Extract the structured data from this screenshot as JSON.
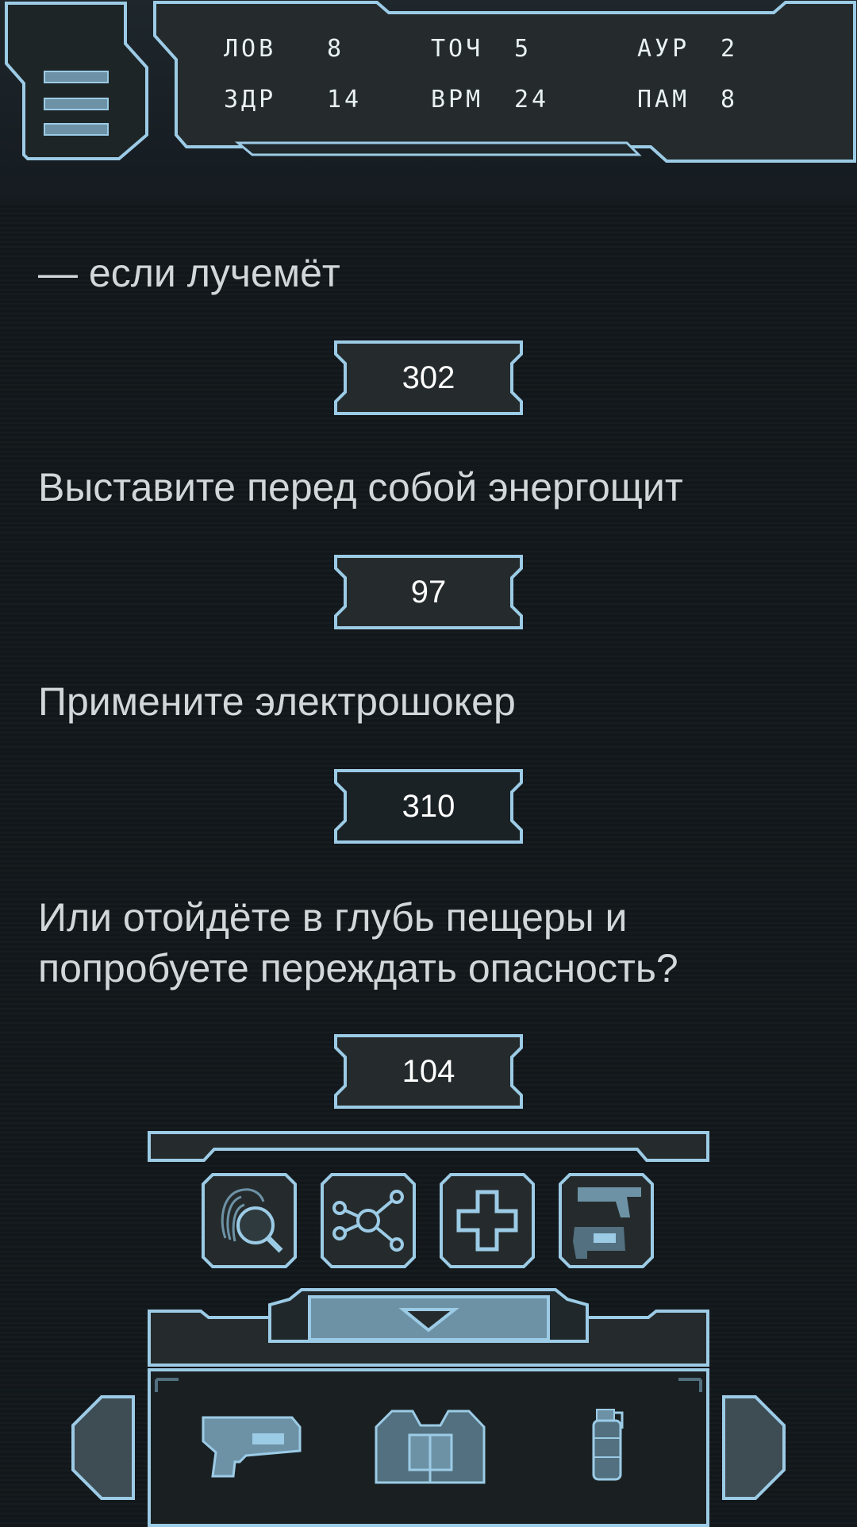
{
  "stats": {
    "row1": [
      {
        "label": "ЛОВ",
        "value": "8"
      },
      {
        "label": "ТОЧ",
        "value": "5"
      },
      {
        "label": "АУР",
        "value": "2"
      }
    ],
    "row2": [
      {
        "label": "ЗДР",
        "value": "14"
      },
      {
        "label": "ВРМ",
        "value": "24"
      },
      {
        "label": "ПАМ",
        "value": "8"
      }
    ]
  },
  "story": {
    "lines": [
      "— если лучемёт",
      "Выставите перед собой энергощит",
      "Примените электрошокер",
      "Или отойдёте в глубь пещеры и попробуете переждать опасность?"
    ]
  },
  "choices": [
    "302",
    "97",
    "310",
    "104"
  ],
  "colors": {
    "accent": "#9ccbe6",
    "panel_fill": "#22292a",
    "background": "#12171b",
    "text": "#d2d7da"
  },
  "toolbar": {
    "icons": [
      "fingerprint-scan-icon",
      "network-nodes-icon",
      "medical-cross-icon",
      "weapons-icon"
    ]
  },
  "inventory": {
    "items": [
      "blaster-pistol-icon",
      "armor-vest-icon",
      "grenade-icon"
    ]
  }
}
